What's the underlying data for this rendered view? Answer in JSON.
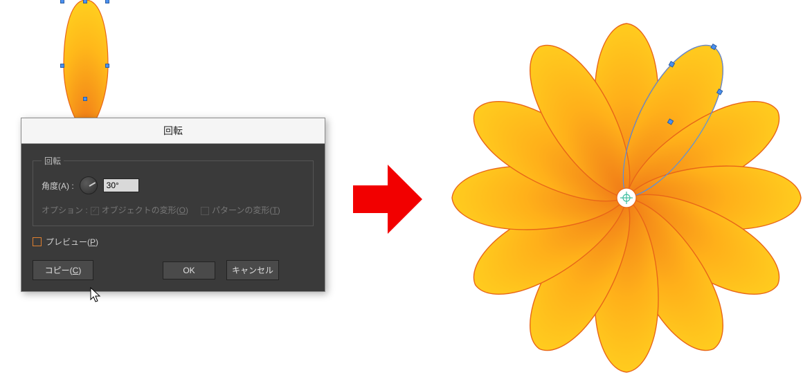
{
  "dialog": {
    "title": "回転",
    "group_legend": "回転",
    "angle_label": "角度(A) :",
    "angle_value": "30°",
    "options_label": "オプション :",
    "option_object": "オブジェクトの変形(O)",
    "option_pattern": "パターンの変形(T)",
    "preview_label": "プレビュー(P)",
    "copy_btn": "コピー(C)",
    "ok_btn": "OK",
    "cancel_btn": "キャンセル"
  },
  "colors": {
    "petal_fill_outer": "#ffcf1f",
    "petal_fill_inner": "#f07a18",
    "petal_stroke": "#e86518",
    "arrow": "#f20000",
    "handle": "#4a90f0"
  },
  "flower": {
    "petal_count": 12,
    "rotation_step_deg": 30,
    "selected_petal_angle_deg": 30
  }
}
